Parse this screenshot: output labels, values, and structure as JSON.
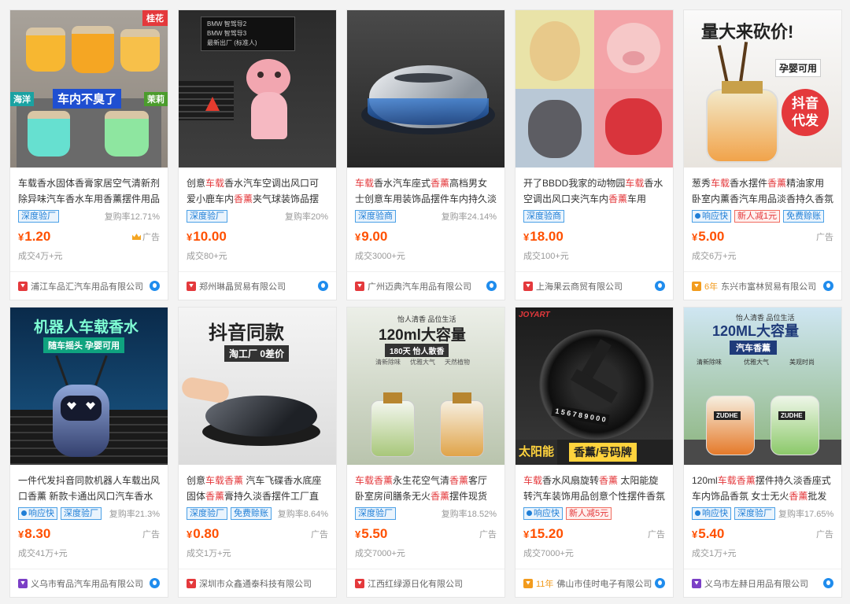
{
  "products": [
    {
      "image_label": "air freshener gel jars",
      "image_texts": [
        "桂花",
        "海洋",
        "车内不臭了",
        "茉莉"
      ],
      "title_parts": [
        {
          "t": "车载香水固体香膏家居空气清新剂除异味汽车香水车用香薰摆件用品",
          "h": false
        }
      ],
      "tags": [
        {
          "label": "深度验厂",
          "style": "blue",
          "dot": false
        }
      ],
      "repurchase": "复购率12.71%",
      "price_symbol": "¥",
      "price": "1.20",
      "ad_label": "广告",
      "ad_crown": true,
      "sold": "成交4万+元",
      "shop_years": "",
      "shop_icon": "red",
      "shop": "浦江车品汇汽车用品有限公司"
    },
    {
      "image_label": "pink deer vent clip",
      "image_texts": [
        "BMW 智驾导2",
        "BMW 智驾导3",
        "最新出厂 (标准人)"
      ],
      "title_parts": [
        {
          "t": "创意",
          "h": false
        },
        {
          "t": "车载",
          "h": true
        },
        {
          "t": "香水汽车空调出风口可爱小鹿车内",
          "h": false
        },
        {
          "t": "香薰",
          "h": true
        },
        {
          "t": "夹气球装饰品摆件女",
          "h": false
        }
      ],
      "tags": [
        {
          "label": "深度验厂",
          "style": "blue",
          "dot": false
        }
      ],
      "repurchase": "复购率20%",
      "price_symbol": "¥",
      "price": "10.00",
      "ad_label": "",
      "ad_crown": false,
      "sold": "成交80+元",
      "shop_years": "",
      "shop_icon": "red",
      "shop": "郑州琳晶贸易有限公司"
    },
    {
      "image_label": "silver dashboard diffuser",
      "image_texts": [],
      "title_parts": [
        {
          "t": "车载",
          "h": true
        },
        {
          "t": "香水汽车座式",
          "h": false
        },
        {
          "t": "香薰",
          "h": true
        },
        {
          "t": "高档男女士创意车用装饰品摆件车内持久淡香",
          "h": false
        }
      ],
      "tags": [
        {
          "label": "深度验商",
          "style": "blue",
          "dot": false
        }
      ],
      "repurchase": "复购率24.14%",
      "price_symbol": "¥",
      "price": "9.00",
      "ad_label": "",
      "ad_crown": false,
      "sold": "成交3000+元",
      "shop_years": "",
      "shop_icon": "red",
      "shop": "广州迈典汽车用品有限公司"
    },
    {
      "image_label": "animal face vent clips",
      "image_texts": [],
      "title_parts": [
        {
          "t": "开了BBDD我家的动物园",
          "h": false
        },
        {
          "t": "车载",
          "h": true
        },
        {
          "t": "香水空调出风口夹汽车内",
          "h": false
        },
        {
          "t": "香薰",
          "h": true
        },
        {
          "t": "车用",
          "h": false
        }
      ],
      "tags": [
        {
          "label": "深度验商",
          "style": "blue",
          "dot": false
        }
      ],
      "repurchase": "",
      "price_symbol": "¥",
      "price": "18.00",
      "ad_label": "",
      "ad_crown": false,
      "sold": "成交100+元",
      "shop_years": "",
      "shop_icon": "red",
      "shop": "上海果云商贸有限公司"
    },
    {
      "image_label": "reed diffuser bottle",
      "image_texts": [
        "量大来砍价!",
        "孕婴可用",
        "抖音代发"
      ],
      "title_parts": [
        {
          "t": "葱秀",
          "h": false
        },
        {
          "t": "车载",
          "h": true
        },
        {
          "t": "香水摆件",
          "h": false
        },
        {
          "t": "香薰",
          "h": true
        },
        {
          "t": "精油家用卧室内薰香汽车用品淡香持久香氛座",
          "h": false
        }
      ],
      "tags": [
        {
          "label": "响应快",
          "style": "blue",
          "dot": true
        },
        {
          "label": "新人减1元",
          "style": "red",
          "dot": false
        },
        {
          "label": "免费赊账",
          "style": "blue",
          "dot": false
        }
      ],
      "repurchase": "",
      "price_symbol": "¥",
      "price": "5.00",
      "ad_label": "广告",
      "ad_crown": false,
      "sold": "成交6万+元",
      "shop_years": "6年",
      "shop_icon": "orange",
      "shop": "东兴市富林贸易有限公司"
    },
    {
      "image_label": "robot vent freshener",
      "image_texts": [
        "机器人车载香水",
        "随车摇头 孕婴可用"
      ],
      "title_parts": [
        {
          "t": "一件代发抖音同款机器人车载出风口香薰 新款卡通出风口汽车香水",
          "h": false
        }
      ],
      "tags": [
        {
          "label": "响应快",
          "style": "blue",
          "dot": true
        },
        {
          "label": "深度验厂",
          "style": "blue",
          "dot": false
        }
      ],
      "repurchase": "复购率21.3%",
      "price_symbol": "¥",
      "price": "8.30",
      "ad_label": "广告",
      "ad_crown": false,
      "sold": "成交41万+元",
      "shop_years": "",
      "shop_icon": "purple",
      "shop": "义乌市宥品汽车用品有限公司"
    },
    {
      "image_label": "black UFO solid freshener",
      "image_texts": [
        "抖音同款",
        "淘工厂 0差价"
      ],
      "title_parts": [
        {
          "t": "创意",
          "h": false
        },
        {
          "t": "车载香薰",
          "h": true
        },
        {
          "t": " 汽车飞碟香水底座固体",
          "h": false
        },
        {
          "t": "香薰",
          "h": true
        },
        {
          "t": "膏持久淡香摆件工厂直销",
          "h": false
        }
      ],
      "tags": [
        {
          "label": "深度验厂",
          "style": "blue",
          "dot": false
        },
        {
          "label": "免费赊账",
          "style": "blue",
          "dot": false
        }
      ],
      "repurchase": "复购率8.64%",
      "price_symbol": "¥",
      "price": "0.80",
      "ad_label": "广告",
      "ad_crown": false,
      "sold": "成交1万+元",
      "shop_years": "",
      "shop_icon": "red",
      "shop": "深圳市众鑫通泰科技有限公司"
    },
    {
      "image_label": "120ml reed diffusers",
      "image_texts": [
        "怡人清香 品位生活",
        "120ml大容量",
        "180天 怡人散香",
        "清新除味",
        "优雅大气",
        "天然植物"
      ],
      "title_parts": [
        {
          "t": "车载香薰",
          "h": true
        },
        {
          "t": "永生花空气清",
          "h": false
        },
        {
          "t": "香薰",
          "h": true
        },
        {
          "t": "客厅卧室房间膳条无火",
          "h": false
        },
        {
          "t": "香薰",
          "h": true
        },
        {
          "t": "摆件现货批发",
          "h": false
        }
      ],
      "tags": [
        {
          "label": "深度验厂",
          "style": "blue",
          "dot": false
        }
      ],
      "repurchase": "复购率18.52%",
      "price_symbol": "¥",
      "price": "5.50",
      "ad_label": "广告",
      "ad_crown": false,
      "sold": "成交7000+元",
      "shop_years": "",
      "shop_icon": "red",
      "shop": "江西红绿源日化有限公司"
    },
    {
      "image_label": "solar rotating freshener",
      "image_texts": [
        "JOYART",
        "1 5 6 7 8 9 0 0 0",
        "太阳能",
        "香薰/号码牌"
      ],
      "title_parts": [
        {
          "t": "车载",
          "h": true
        },
        {
          "t": "香水风扇旋转",
          "h": false
        },
        {
          "t": "香薰",
          "h": true
        },
        {
          "t": " 太阳能旋转汽车装饰用品创意个性摆件香氛 汽车",
          "h": false
        },
        {
          "t": "香薰",
          "h": true
        }
      ],
      "tags": [
        {
          "label": "响应快",
          "style": "blue",
          "dot": true
        },
        {
          "label": "新人减5元",
          "style": "red",
          "dot": false
        }
      ],
      "repurchase": "",
      "price_symbol": "¥",
      "price": "15.20",
      "ad_label": "广告",
      "ad_crown": false,
      "sold": "成交7000+元",
      "shop_years": "11年",
      "shop_icon": "orange",
      "shop": "佛山市佳时电子有限公司"
    },
    {
      "image_label": "120ML car aroma bottles",
      "image_texts": [
        "怡人清香 品位生活",
        "120ML大容量",
        "汽车香薰",
        "清新除味",
        "优雅大气",
        "美观时尚",
        "ZUDHE",
        "ZUDHE"
      ],
      "title_parts": [
        {
          "t": "120ml",
          "h": false
        },
        {
          "t": "车载香薰",
          "h": true
        },
        {
          "t": "摆件持久淡香座式车内饰品香氛 女士无火",
          "h": false
        },
        {
          "t": "香薰",
          "h": true
        },
        {
          "t": "批发",
          "h": false
        }
      ],
      "tags": [
        {
          "label": "响应快",
          "style": "blue",
          "dot": true
        },
        {
          "label": "深度验厂",
          "style": "blue",
          "dot": false
        }
      ],
      "repurchase": "复购率17.65%",
      "price_symbol": "¥",
      "price": "5.40",
      "ad_label": "广告",
      "ad_crown": false,
      "sold": "成交1万+元",
      "shop_years": "",
      "shop_icon": "purple",
      "shop": "义乌市左赫日用品有限公司"
    }
  ]
}
